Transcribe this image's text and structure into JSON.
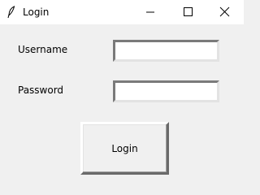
{
  "window": {
    "title": "Login",
    "icon": "feather-icon",
    "controls": [
      "minimize-icon",
      "maximize-icon",
      "close-icon"
    ]
  },
  "form": {
    "username_label": "Username",
    "username_value": "",
    "password_label": "Password",
    "password_value": "",
    "login_label": "Login"
  }
}
